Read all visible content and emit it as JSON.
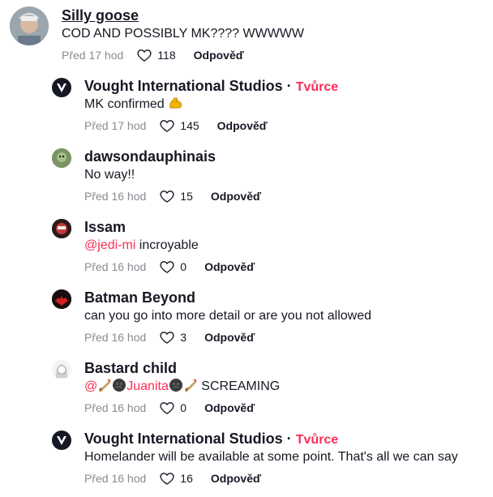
{
  "comments": [
    {
      "author": "Silly goose",
      "text": "COD AND POSSIBLY MK???? WWWWW",
      "time": "Před 17 hod",
      "likes": "118",
      "reply": "Odpověď"
    },
    {
      "author": "Vought International Studios",
      "separator": "·",
      "badge": "Tvůrce",
      "text": "MK confirmed",
      "emoji": "flexed-biceps",
      "time": "Před 17 hod",
      "likes": "145",
      "reply": "Odpověď"
    },
    {
      "author": "dawsondauphinais",
      "text": "No way!!",
      "time": "Před 16 hod",
      "likes": "15",
      "reply": "Odpověď"
    },
    {
      "author": "Issam",
      "mention": "@jedi-mi",
      "text": " incroyable",
      "time": "Před 16 hod",
      "likes": "0",
      "reply": "Odpověď"
    },
    {
      "author": "Batman Beyond",
      "text": "can you go into more detail or are you not allowed",
      "time": "Před 16 hod",
      "likes": "3",
      "reply": "Odpověď"
    },
    {
      "author": "Bastard child",
      "mention_prefix": "@",
      "mention_name": "Juanita",
      "text": " SCREAMING",
      "emojis": [
        "rocket-sword",
        "dark-face",
        "dark-face",
        "rocket-sword"
      ],
      "time": "Před 16 hod",
      "likes": "0",
      "reply": "Odpověď"
    },
    {
      "author": "Vought International Studios",
      "separator": "·",
      "badge": "Tvůrce",
      "text": "Homelander will be available at some point. That's all we can say",
      "time": "Před 16 hod",
      "likes": "16",
      "reply": "Odpověď"
    }
  ],
  "colors": {
    "accent": "#fe2c55",
    "text": "#161823",
    "muted": "#8a8b91"
  }
}
